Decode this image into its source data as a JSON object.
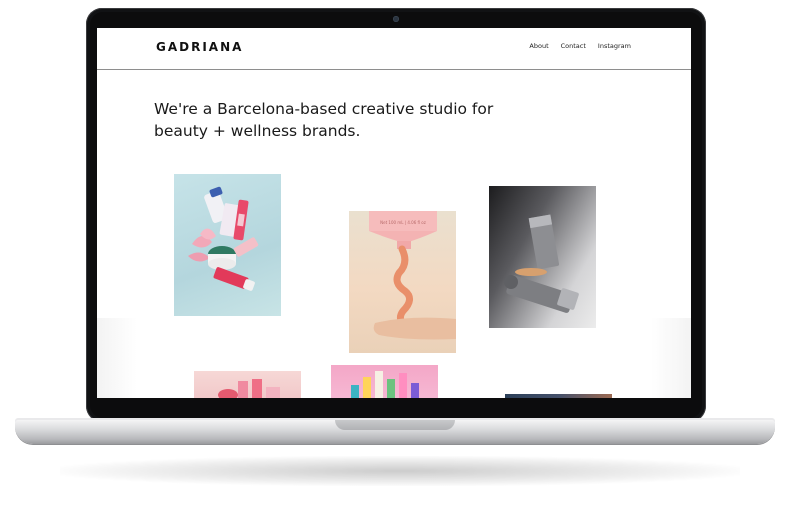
{
  "site": {
    "logo": "GADRIANA",
    "nav": [
      "About",
      "Contact",
      "Instagram"
    ],
    "headline": "We're a Barcelona-based creative studio for beauty + wellness brands."
  },
  "gallery": {
    "tube2_label": "Net 100 mL | 4.06 fl oz"
  }
}
